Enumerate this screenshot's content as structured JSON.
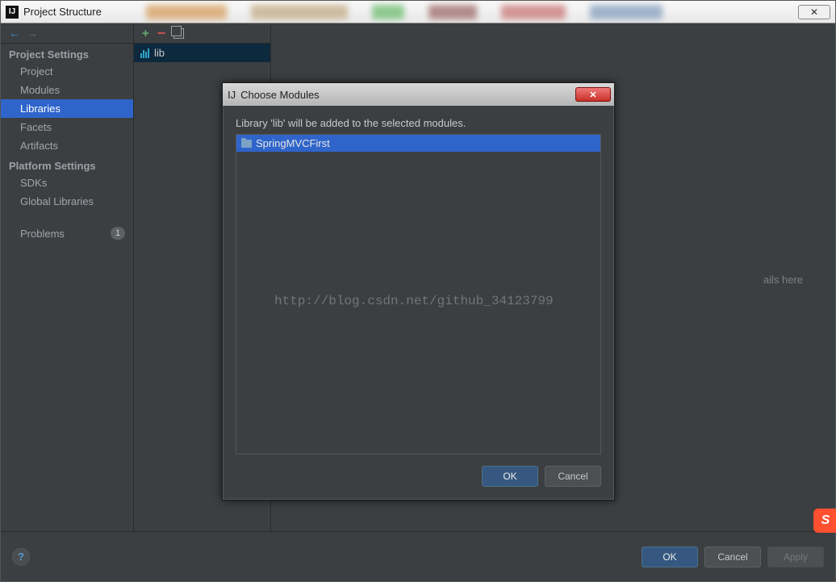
{
  "titlebar": {
    "title": "Project Structure"
  },
  "sidebar": {
    "section_project": "Project Settings",
    "items_project": [
      {
        "label": "Project"
      },
      {
        "label": "Modules"
      },
      {
        "label": "Libraries"
      },
      {
        "label": "Facets"
      },
      {
        "label": "Artifacts"
      }
    ],
    "section_platform": "Platform Settings",
    "items_platform": [
      {
        "label": "SDKs"
      },
      {
        "label": "Global Libraries"
      }
    ],
    "problems_label": "Problems",
    "problems_count": "1"
  },
  "liblist": {
    "items": [
      {
        "name": "lib"
      }
    ]
  },
  "details_hint": "ails here",
  "bottom": {
    "ok": "OK",
    "cancel": "Cancel",
    "apply": "Apply"
  },
  "modal": {
    "title": "Choose Modules",
    "message": "Library 'lib' will be added to the selected modules.",
    "modules": [
      {
        "name": "SpringMVCFirst"
      }
    ],
    "ok": "OK",
    "cancel": "Cancel"
  },
  "watermark": "http://blog.csdn.net/github_34123799",
  "badge": "S"
}
